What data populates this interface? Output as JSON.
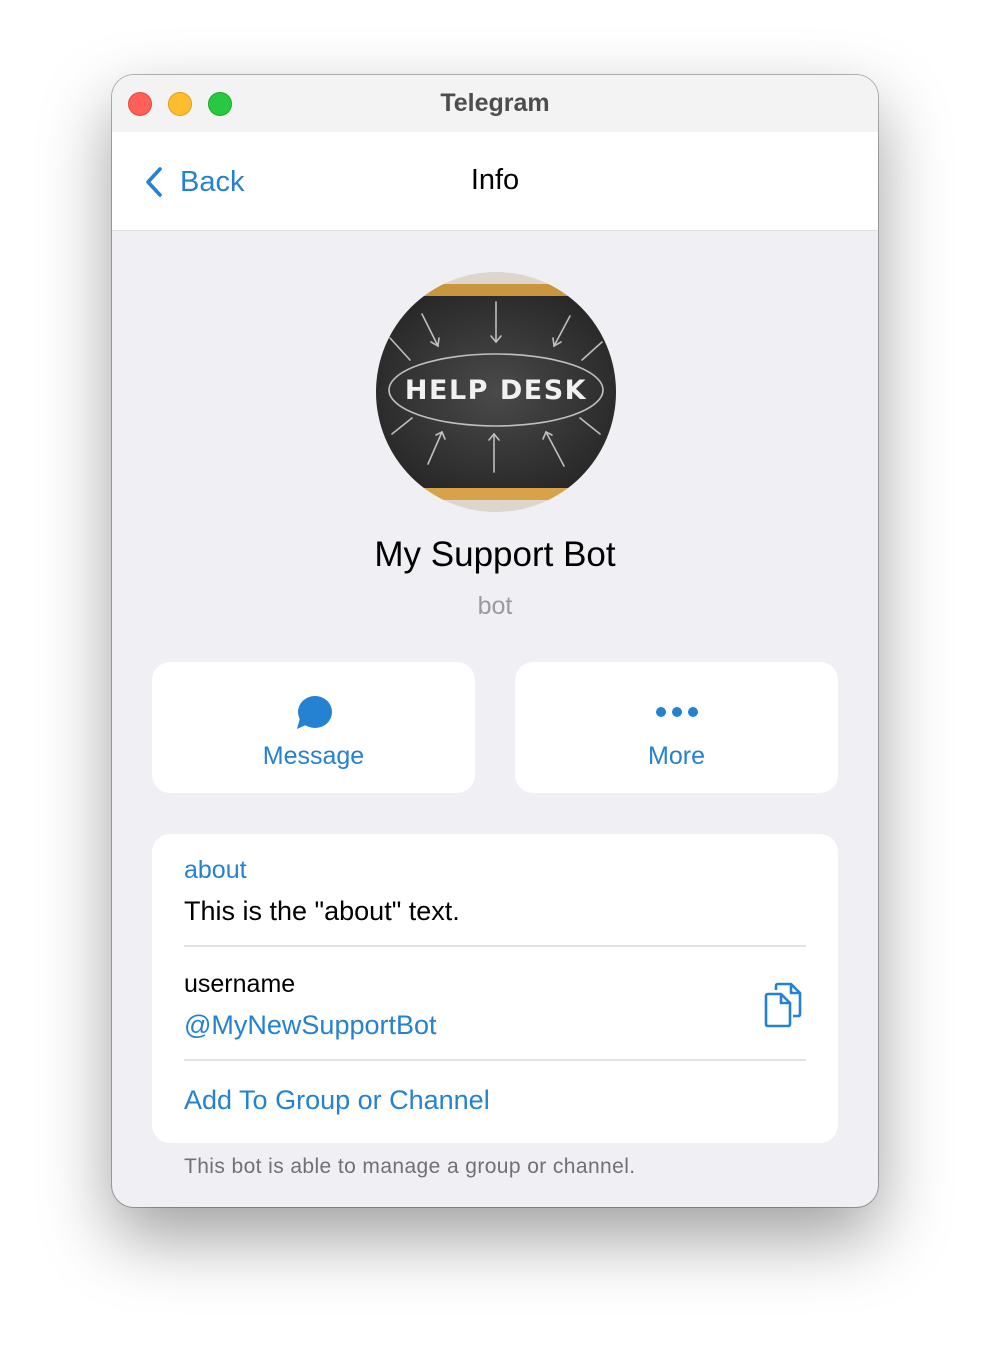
{
  "window": {
    "title": "Telegram"
  },
  "navbar": {
    "back_label": "Back",
    "title": "Info"
  },
  "avatar": {
    "text": "HELP DESK"
  },
  "profile": {
    "name": "My Support Bot",
    "subtitle": "bot"
  },
  "actions": {
    "message_label": "Message",
    "message_icon": "chat-bubble-icon",
    "more_label": "More",
    "more_icon": "ellipsis-icon"
  },
  "info": {
    "about_label": "about",
    "about_text": "This is the \"about\" text.",
    "username_label": "username",
    "username_value": "@MyNewSupportBot",
    "copy_icon": "copy-icon",
    "add_link": "Add To Group or Channel"
  },
  "footer": {
    "note": "This bot is able to manage a group or channel."
  },
  "colors": {
    "accent": "#2581d1",
    "background": "#efeff4",
    "card": "#ffffff"
  }
}
